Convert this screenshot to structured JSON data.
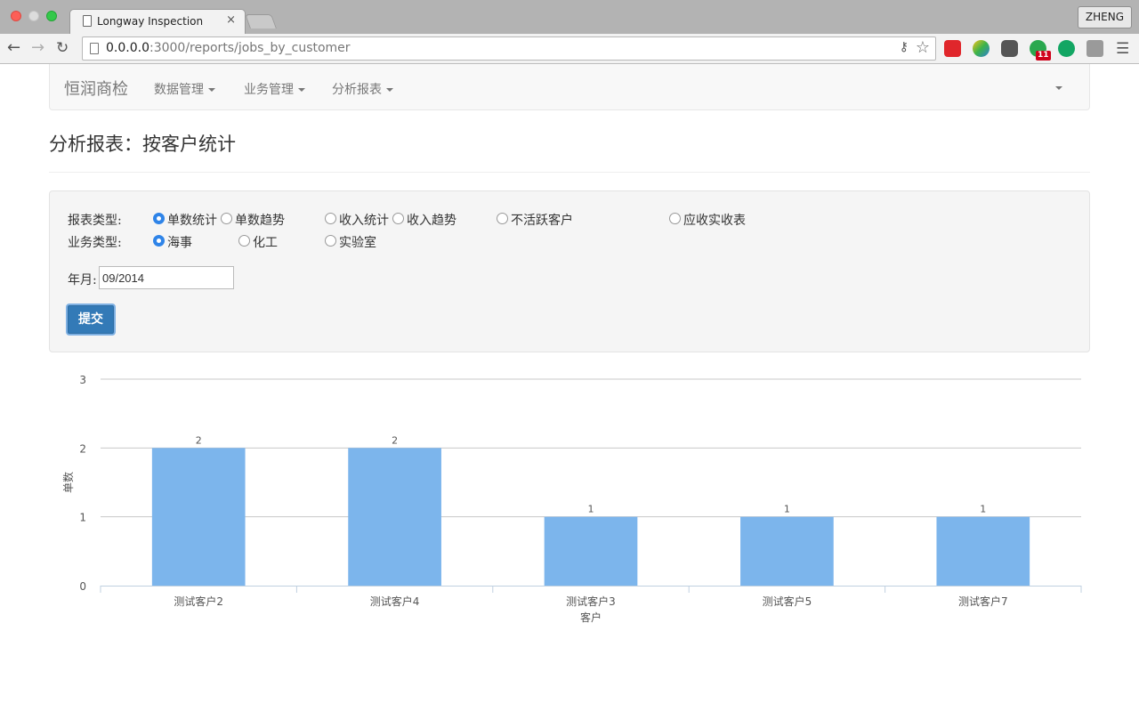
{
  "browser": {
    "tab_title": "Longway Inspection",
    "tab_close": "×",
    "url_host": "0.0.0.0",
    "url_rest": ":3000/reports/jobs_by_customer",
    "profile": "ZHENG",
    "ext_badge": "11"
  },
  "navbar": {
    "brand": "恒润商检",
    "items": [
      {
        "label": "数据管理"
      },
      {
        "label": "业务管理"
      },
      {
        "label": "分析报表"
      }
    ]
  },
  "page": {
    "title": "分析报表：按客户统计"
  },
  "form": {
    "report_type_label": "报表类型:",
    "report_types": [
      {
        "label": "单数统计",
        "checked": true
      },
      {
        "label": "单数趋势",
        "checked": false
      },
      {
        "label": "收入统计",
        "checked": false
      },
      {
        "label": "收入趋势",
        "checked": false
      },
      {
        "label": "不活跃客户",
        "checked": false
      },
      {
        "label": "应收实收表",
        "checked": false
      }
    ],
    "business_type_label": "业务类型:",
    "business_types": [
      {
        "label": "海事",
        "checked": true
      },
      {
        "label": "化工",
        "checked": false
      },
      {
        "label": "实验室",
        "checked": false
      }
    ],
    "month_label": "年月:",
    "month_value": "09/2014",
    "submit_label": "提交"
  },
  "chart_data": {
    "type": "bar",
    "categories": [
      "测试客户2",
      "测试客户4",
      "测试客户3",
      "测试客户5",
      "测试客户7"
    ],
    "values": [
      2,
      2,
      1,
      1,
      1
    ],
    "xlabel": "客户",
    "ylabel": "单数",
    "ylim": [
      0,
      3
    ],
    "yticks": [
      0,
      1,
      2,
      3
    ],
    "grid": true,
    "data_labels": true,
    "bar_color": "#7cb5ec"
  }
}
